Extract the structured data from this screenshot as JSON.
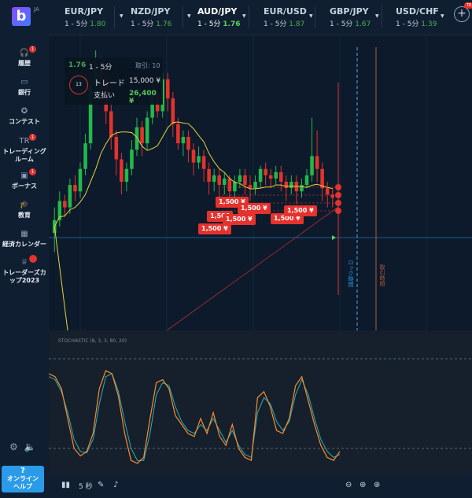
{
  "brand": {
    "logo": "b",
    "lang": "JA"
  },
  "sidebar": [
    {
      "label": "履歴",
      "icon": "headset-icon",
      "badge": "1"
    },
    {
      "label": "銀行",
      "icon": "wallet-icon"
    },
    {
      "label": "コンテスト",
      "icon": "trophy-icon"
    },
    {
      "label": "トレーディング\nルーム",
      "icon": "tr-icon",
      "badge": "1",
      "icon_text": "TR"
    },
    {
      "label": "ボーナス",
      "icon": "gift-icon",
      "badge": "1"
    },
    {
      "label": "教育",
      "icon": "graduation-icon"
    },
    {
      "label": "経済カレンダー",
      "icon": "calendar-icon"
    },
    {
      "label": "トレーダーズカ\nップ2023",
      "icon": "cup-icon",
      "badge": ""
    }
  ],
  "help": {
    "q": "?",
    "label": "オンライン\nヘルプ"
  },
  "tabs": [
    {
      "pair": "EUR/JPY",
      "dur": "1 - 5分",
      "payout": "1.80"
    },
    {
      "pair": "NZD/JPY",
      "dur": "1 - 5分",
      "payout": "1.76"
    },
    {
      "pair": "AUD/JPY",
      "dur": "1 - 5分",
      "payout": "1.76",
      "active": true
    },
    {
      "pair": "EUR/USD",
      "dur": "1 - 5分",
      "payout": "1.87"
    },
    {
      "pair": "GBP/JPY",
      "dur": "1 - 5分",
      "payout": "1.67"
    },
    {
      "pair": "USD/CHF",
      "dur": "1 - 5分",
      "payout": "1.39"
    }
  ],
  "plus_badge": "TR",
  "info": {
    "payout": "1.76",
    "duration": "1 - 5分",
    "trades_label": "取引: 10",
    "timer": "13",
    "trade_label": "トレード",
    "trade_value": "15,000 ¥",
    "pay_label": "支払い",
    "pay_value": "26,400 ¥"
  },
  "tags": [
    {
      "text": "1,500 ¥"
    },
    {
      "text": "1,500"
    },
    {
      "text": "1,500 ¥"
    },
    {
      "text": "1,500 ¥"
    },
    {
      "text": "1,500 ¥"
    },
    {
      "text": "1,500 ¥"
    },
    {
      "text": "1,500 ¥"
    }
  ],
  "vertical_labels": {
    "lock": "ロック時間",
    "expiry": "取引時間"
  },
  "stochastic": {
    "title": "STOCHASTIC (8, 3, 3, 80, 20)"
  },
  "toolbar": {
    "timeframe": "5 秒"
  },
  "colors": {
    "up": "#22b94a",
    "down": "#e5322d",
    "ma": "#e8d23a",
    "k": "#ff8a2b",
    "d": "#2ab0b8",
    "accent": "#2a9be8"
  },
  "chart_data": {
    "type": "candlestick",
    "candles": [
      [
        42,
        46,
        36,
        50
      ],
      [
        46,
        52,
        44,
        55
      ],
      [
        52,
        50,
        47,
        54
      ],
      [
        50,
        57,
        48,
        59
      ],
      [
        57,
        55,
        52,
        60
      ],
      [
        55,
        62,
        53,
        64
      ],
      [
        62,
        70,
        60,
        73
      ],
      [
        70,
        88,
        68,
        92
      ],
      [
        88,
        95,
        86,
        99
      ],
      [
        95,
        90,
        84,
        97
      ],
      [
        90,
        80,
        76,
        92
      ],
      [
        80,
        72,
        68,
        82
      ],
      [
        72,
        65,
        60,
        74
      ],
      [
        65,
        58,
        54,
        67
      ],
      [
        58,
        62,
        55,
        64
      ],
      [
        62,
        68,
        60,
        71
      ],
      [
        68,
        75,
        66,
        78
      ],
      [
        75,
        70,
        66,
        77
      ],
      [
        70,
        78,
        68,
        80
      ],
      [
        78,
        85,
        76,
        89
      ],
      [
        85,
        80,
        78,
        88
      ],
      [
        80,
        90,
        78,
        92
      ],
      [
        90,
        84,
        80,
        92
      ],
      [
        84,
        76,
        72,
        86
      ],
      [
        76,
        70,
        68,
        78
      ],
      [
        70,
        72,
        66,
        74
      ],
      [
        72,
        68,
        64,
        74
      ],
      [
        68,
        64,
        60,
        70
      ],
      [
        64,
        66,
        62,
        69
      ],
      [
        66,
        62,
        58,
        68
      ],
      [
        62,
        58,
        54,
        64
      ],
      [
        58,
        60,
        55,
        62
      ],
      [
        60,
        57,
        53,
        62
      ],
      [
        57,
        59,
        54,
        61
      ],
      [
        59,
        55,
        52,
        60
      ],
      [
        55,
        58,
        53,
        60
      ],
      [
        58,
        60,
        56,
        62
      ],
      [
        60,
        57,
        54,
        62
      ],
      [
        57,
        56,
        52,
        60
      ],
      [
        56,
        58,
        54,
        60
      ],
      [
        58,
        62,
        56,
        63
      ],
      [
        62,
        60,
        57,
        64
      ],
      [
        60,
        59,
        56,
        62
      ],
      [
        59,
        61,
        57,
        63
      ],
      [
        61,
        58,
        55,
        63
      ],
      [
        58,
        56,
        52,
        60
      ],
      [
        56,
        58,
        54,
        60
      ],
      [
        58,
        55,
        51,
        60
      ],
      [
        55,
        57,
        53,
        59
      ],
      [
        57,
        60,
        56,
        62
      ],
      [
        60,
        66,
        58,
        78
      ],
      [
        66,
        62,
        58,
        74
      ],
      [
        62,
        56,
        52,
        64
      ],
      [
        56,
        54,
        50,
        58
      ],
      [
        54,
        53,
        50,
        56
      ]
    ],
    "stoch_k": [
      70,
      68,
      60,
      40,
      20,
      15,
      18,
      30,
      60,
      72,
      70,
      55,
      30,
      12,
      10,
      14,
      40,
      64,
      66,
      60,
      42,
      36,
      30,
      28,
      40,
      30,
      44,
      28,
      22,
      36,
      20,
      14,
      12,
      54,
      58,
      48,
      32,
      30,
      40,
      62,
      68,
      52,
      36,
      22,
      14,
      12,
      18
    ],
    "stoch_d": [
      68,
      66,
      58,
      44,
      26,
      18,
      17,
      26,
      50,
      68,
      70,
      58,
      38,
      20,
      12,
      12,
      30,
      56,
      64,
      62,
      48,
      38,
      32,
      30,
      36,
      32,
      40,
      32,
      24,
      32,
      22,
      16,
      14,
      44,
      54,
      50,
      38,
      32,
      38,
      56,
      66,
      56,
      40,
      26,
      18,
      14,
      16
    ]
  }
}
